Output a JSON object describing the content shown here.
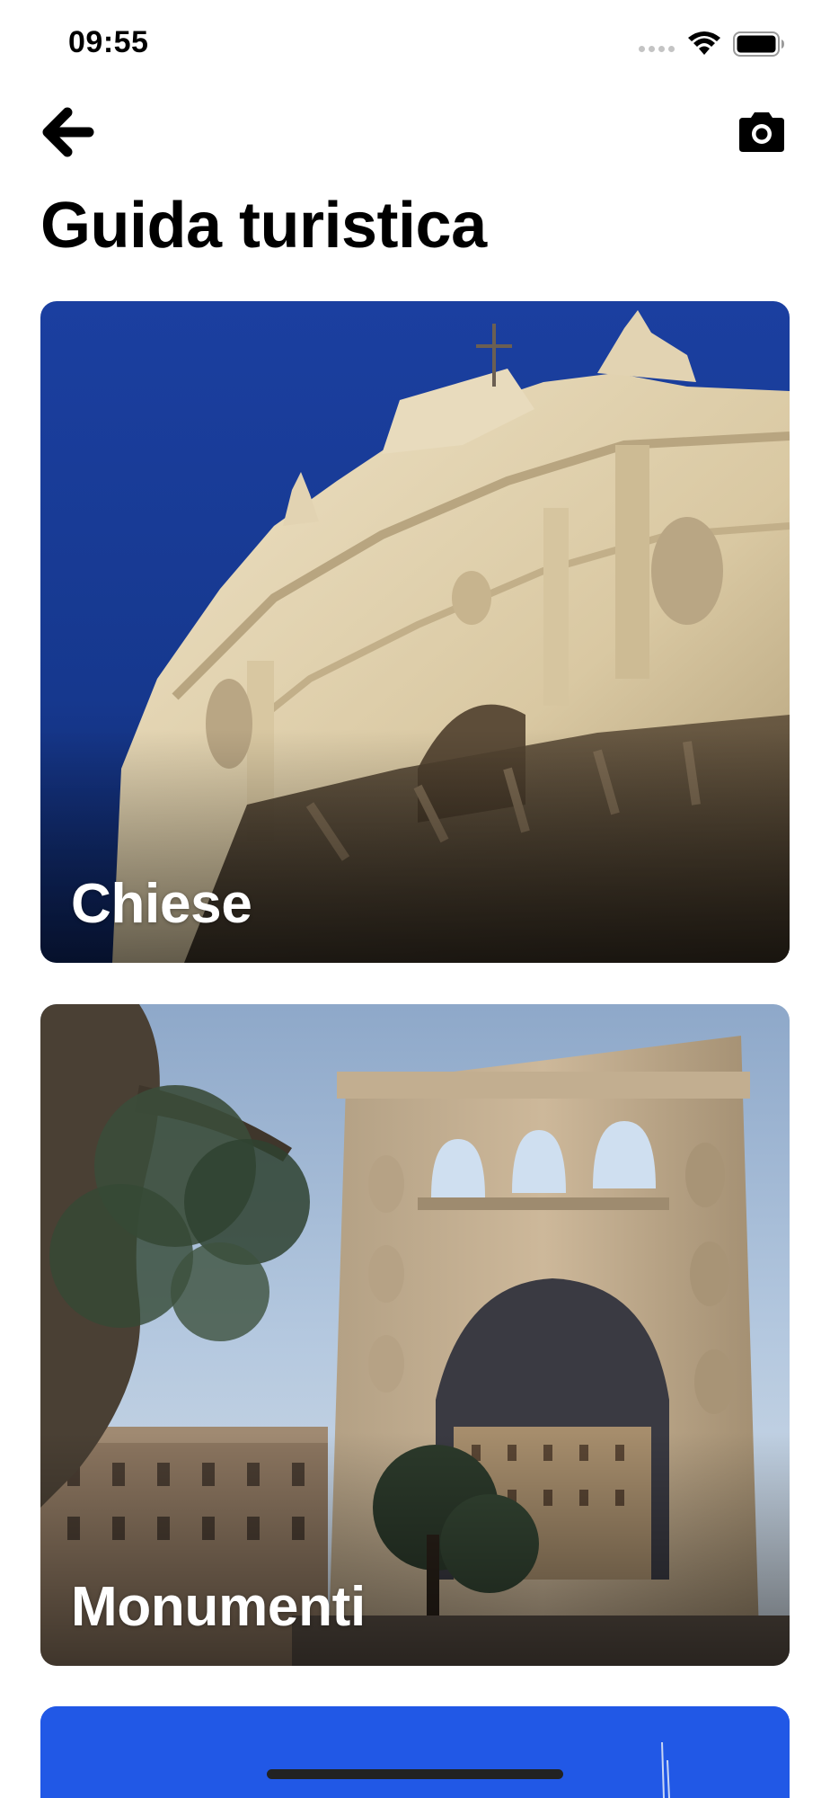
{
  "status_bar": {
    "time": "09:55",
    "icons": [
      "signal-dots-icon",
      "wifi-icon",
      "battery-icon"
    ]
  },
  "nav": {
    "back_icon": "arrow-left-icon",
    "camera_icon": "camera-icon"
  },
  "page": {
    "title": "Guida turistica"
  },
  "categories": [
    {
      "label": "Chiese",
      "image": "baroque-church-facade"
    },
    {
      "label": "Monumenti",
      "image": "triumphal-arch-with-olive-tree"
    },
    {
      "label": "",
      "image": "blue-sky"
    }
  ],
  "colors": {
    "background": "#ffffff",
    "text": "#000000",
    "card_label": "#ffffff",
    "sky_church": "#1a3f9a",
    "sky_monument": "#a9c2e0"
  }
}
